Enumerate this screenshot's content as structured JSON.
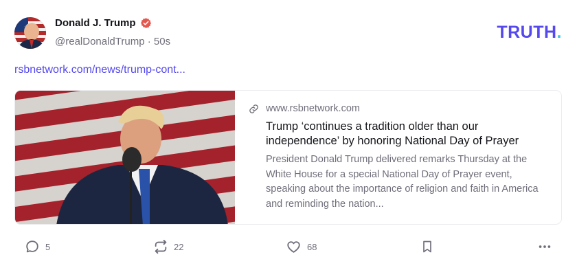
{
  "post": {
    "author_name": "Donald J. Trump",
    "handle": "@realDonaldTrump",
    "separator": "·",
    "time": "50s",
    "link_text": "rsbnetwork.com/news/trump-cont..."
  },
  "brand": {
    "text": "TRUTH",
    "dot": "."
  },
  "card": {
    "domain": "www.rsbnetwork.com",
    "title": "Trump ‘continues a tradition older than our independence’ by honoring National Day of Prayer",
    "description": "President Donald Trump delivered remarks Thursday at the White House for a special National Day of Prayer event, speaking about the importance of religion and faith in America and reminding the nation..."
  },
  "actions": {
    "replies": "5",
    "retruths": "22",
    "likes": "68"
  },
  "colors": {
    "brand_purple": "#5448ee",
    "brand_cyan": "#3bc6e3",
    "verified_red": "#e4574f",
    "muted_text": "#6f6e7a"
  },
  "icons": [
    "verified-badge-icon",
    "link-icon",
    "reply-icon",
    "retruth-icon",
    "like-icon",
    "bookmark-icon",
    "more-icon"
  ]
}
